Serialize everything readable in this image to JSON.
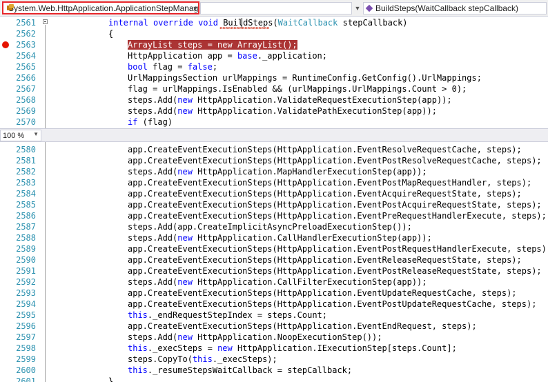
{
  "navbar": {
    "type_selector": "System.Web.HttpApplication.ApplicationStepManager",
    "member_selector": "BuildSteps(WaitCallback stepCallback)",
    "member_icon": "method-icon",
    "class_icon": "class-icon"
  },
  "zoom": {
    "level": "100 %"
  },
  "colors": {
    "keyword": "#0000ff",
    "type": "#2b91af",
    "breakpoint": "#e51400",
    "breakpoint_highlight": "#ab3434",
    "annotation": "#e8262b"
  },
  "top_pane": [
    {
      "n": "2561",
      "t": [
        [
          "kw",
          "internal "
        ],
        [
          "kw",
          "override "
        ],
        [
          "kw",
          "void "
        ],
        [
          "p",
          "BuildSteps("
        ],
        [
          "ty",
          "WaitCallback"
        ],
        [
          "p",
          " stepCallback)"
        ]
      ]
    },
    {
      "n": "2562",
      "t": [
        [
          "p",
          "{"
        ]
      ]
    },
    {
      "n": "2563",
      "bp": true,
      "t": [
        [
          "hl",
          "ArrayList steps = new ArrayList();"
        ]
      ]
    },
    {
      "n": "2564",
      "t": [
        [
          "p",
          "HttpApplication app = "
        ],
        [
          "kw",
          "base"
        ],
        [
          "p",
          "._application;"
        ]
      ]
    },
    {
      "n": "2565",
      "t": [
        [
          "kw",
          "bool"
        ],
        [
          "p",
          " flag = "
        ],
        [
          "kw",
          "false"
        ],
        [
          "p",
          ";"
        ]
      ]
    },
    {
      "n": "2566",
      "t": [
        [
          "p",
          "UrlMappingsSection urlMappings = RuntimeConfig.GetConfig().UrlMappings;"
        ]
      ]
    },
    {
      "n": "2567",
      "t": [
        [
          "p",
          "flag = urlMappings.IsEnabled && (urlMappings.UrlMappings.Count > 0);"
        ]
      ]
    },
    {
      "n": "2568",
      "t": [
        [
          "p",
          "steps.Add("
        ],
        [
          "kw",
          "new"
        ],
        [
          "p",
          " HttpApplication.ValidateRequestExecutionStep(app));"
        ]
      ]
    },
    {
      "n": "2569",
      "t": [
        [
          "p",
          "steps.Add("
        ],
        [
          "kw",
          "new"
        ],
        [
          "p",
          " HttpApplication.ValidatePathExecutionStep(app));"
        ]
      ]
    },
    {
      "n": "2570",
      "t": [
        [
          "kw",
          "if"
        ],
        [
          "p",
          " (flag)"
        ]
      ]
    },
    {
      "n": "",
      "t": [
        [
          "p",
          "{"
        ]
      ]
    }
  ],
  "bottom_pane": [
    {
      "n": "2580",
      "t": [
        [
          "p",
          "app.CreateEventExecutionSteps(HttpApplication.EventResolveRequestCache, steps);"
        ]
      ]
    },
    {
      "n": "2581",
      "t": [
        [
          "p",
          "app.CreateEventExecutionSteps(HttpApplication.EventPostResolveRequestCache, steps);"
        ]
      ]
    },
    {
      "n": "2582",
      "t": [
        [
          "p",
          "steps.Add("
        ],
        [
          "kw",
          "new"
        ],
        [
          "p",
          " HttpApplication.MapHandlerExecutionStep(app));"
        ]
      ]
    },
    {
      "n": "2583",
      "t": [
        [
          "p",
          "app.CreateEventExecutionSteps(HttpApplication.EventPostMapRequestHandler, steps);"
        ]
      ]
    },
    {
      "n": "2584",
      "t": [
        [
          "p",
          "app.CreateEventExecutionSteps(HttpApplication.EventAcquireRequestState, steps);"
        ]
      ]
    },
    {
      "n": "2585",
      "t": [
        [
          "p",
          "app.CreateEventExecutionSteps(HttpApplication.EventPostAcquireRequestState, steps);"
        ]
      ]
    },
    {
      "n": "2586",
      "t": [
        [
          "p",
          "app.CreateEventExecutionSteps(HttpApplication.EventPreRequestHandlerExecute, steps);"
        ]
      ]
    },
    {
      "n": "2587",
      "t": [
        [
          "p",
          "steps.Add(app.CreateImplicitAsyncPreloadExecutionStep());"
        ]
      ]
    },
    {
      "n": "2588",
      "t": [
        [
          "p",
          "steps.Add("
        ],
        [
          "kw",
          "new"
        ],
        [
          "p",
          " HttpApplication.CallHandlerExecutionStep(app));"
        ]
      ]
    },
    {
      "n": "2589",
      "t": [
        [
          "p",
          "app.CreateEventExecutionSteps(HttpApplication.EventPostRequestHandlerExecute, steps);"
        ]
      ]
    },
    {
      "n": "2590",
      "t": [
        [
          "p",
          "app.CreateEventExecutionSteps(HttpApplication.EventReleaseRequestState, steps);"
        ]
      ]
    },
    {
      "n": "2591",
      "t": [
        [
          "p",
          "app.CreateEventExecutionSteps(HttpApplication.EventPostReleaseRequestState, steps);"
        ]
      ]
    },
    {
      "n": "2592",
      "t": [
        [
          "p",
          "steps.Add("
        ],
        [
          "kw",
          "new"
        ],
        [
          "p",
          " HttpApplication.CallFilterExecutionStep(app));"
        ]
      ]
    },
    {
      "n": "2593",
      "t": [
        [
          "p",
          "app.CreateEventExecutionSteps(HttpApplication.EventUpdateRequestCache, steps);"
        ]
      ]
    },
    {
      "n": "2594",
      "t": [
        [
          "p",
          "app.CreateEventExecutionSteps(HttpApplication.EventPostUpdateRequestCache, steps);"
        ]
      ]
    },
    {
      "n": "2595",
      "t": [
        [
          "kw",
          "this"
        ],
        [
          "p",
          "._endRequestStepIndex = steps.Count;"
        ]
      ]
    },
    {
      "n": "2596",
      "t": [
        [
          "p",
          "app.CreateEventExecutionSteps(HttpApplication.EventEndRequest, steps);"
        ]
      ]
    },
    {
      "n": "2597",
      "t": [
        [
          "p",
          "steps.Add("
        ],
        [
          "kw",
          "new"
        ],
        [
          "p",
          " HttpApplication.NoopExecutionStep());"
        ]
      ]
    },
    {
      "n": "2598",
      "t": [
        [
          "kw",
          "this"
        ],
        [
          "p",
          "._execSteps = "
        ],
        [
          "kw",
          "new"
        ],
        [
          "p",
          " HttpApplication.IExecutionStep[steps.Count];"
        ]
      ]
    },
    {
      "n": "2599",
      "t": [
        [
          "p",
          "steps.CopyTo("
        ],
        [
          "kw",
          "this"
        ],
        [
          "p",
          "._execSteps);"
        ]
      ]
    },
    {
      "n": "2600",
      "t": [
        [
          "kw",
          "this"
        ],
        [
          "p",
          "._resumeStepsWaitCallback = stepCallback;"
        ]
      ]
    },
    {
      "n": "2601",
      "t": [
        [
          "p",
          "}"
        ]
      ]
    }
  ]
}
